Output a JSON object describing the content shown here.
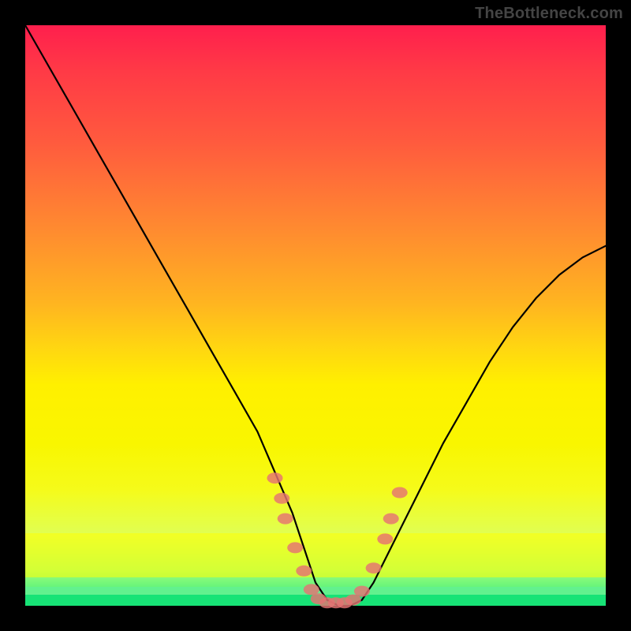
{
  "watermark": "TheBottleneck.com",
  "chart_data": {
    "type": "line",
    "title": "",
    "xlabel": "",
    "ylabel": "",
    "xlim": [
      0,
      100
    ],
    "ylim": [
      0,
      100
    ],
    "series": [
      {
        "name": "bottleneck-curve",
        "x": [
          0,
          4,
          8,
          12,
          16,
          20,
          24,
          28,
          32,
          36,
          40,
          43,
          46,
          48,
          50,
          52,
          54,
          56,
          58,
          60,
          64,
          68,
          72,
          76,
          80,
          84,
          88,
          92,
          96,
          100
        ],
        "y": [
          100,
          93,
          86,
          79,
          72,
          65,
          58,
          51,
          44,
          37,
          30,
          23,
          16,
          10,
          4,
          1,
          0,
          0,
          1,
          4,
          12,
          20,
          28,
          35,
          42,
          48,
          53,
          57,
          60,
          62
        ]
      }
    ],
    "markers": {
      "name": "emphasis-dots",
      "points": [
        {
          "x": 43.0,
          "y": 22.0
        },
        {
          "x": 44.2,
          "y": 18.5
        },
        {
          "x": 44.8,
          "y": 15.0
        },
        {
          "x": 46.5,
          "y": 10.0
        },
        {
          "x": 48.0,
          "y": 6.0
        },
        {
          "x": 49.3,
          "y": 2.8
        },
        {
          "x": 50.5,
          "y": 1.2
        },
        {
          "x": 52.0,
          "y": 0.5
        },
        {
          "x": 53.5,
          "y": 0.5
        },
        {
          "x": 55.0,
          "y": 0.5
        },
        {
          "x": 56.5,
          "y": 1.0
        },
        {
          "x": 58.0,
          "y": 2.5
        },
        {
          "x": 60.0,
          "y": 6.5
        },
        {
          "x": 62.0,
          "y": 11.5
        },
        {
          "x": 63.0,
          "y": 15.0
        },
        {
          "x": 64.5,
          "y": 19.5
        }
      ]
    },
    "gradient_bands": [
      {
        "name": "optimal",
        "color": "#17e376",
        "y_range": [
          0,
          3
        ]
      },
      {
        "name": "warning",
        "color": "#ffff00",
        "y_range": [
          3,
          15
        ]
      }
    ]
  }
}
